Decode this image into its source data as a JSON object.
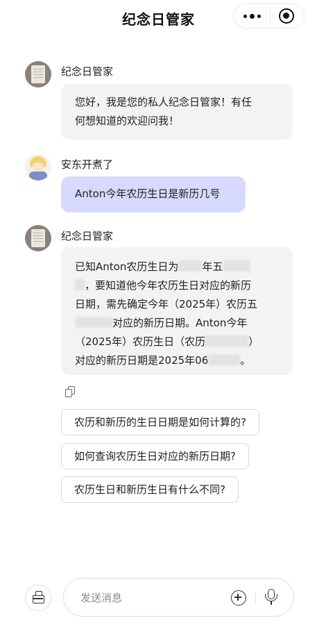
{
  "header": {
    "title": "纪念日管家"
  },
  "messages": [
    {
      "sender": "纪念日管家",
      "lines": [
        "您好，我是您的私人纪念日管家！有任",
        "何想知道的欢迎问我！"
      ]
    },
    {
      "sender": "安东开煮了",
      "text": "Anton今年农历生日是新历几号"
    },
    {
      "sender": "纪念日管家",
      "segments": {
        "l1": "已知Anton农历生日为",
        "l1b": "年五",
        "l2": "，要知道他今年农历生日对应的新历",
        "l3": "日期，需先确定今年（2025年）农历五",
        "l4": "对应的新历日期。Anton今年",
        "l5a": "（2025年）农历生日（农历",
        "l5b": "）",
        "l6a": "对应的新历日期是2025年06",
        "l6b": "。"
      }
    }
  ],
  "suggestions": [
    "农历和新历的生日日期是如何计算的?",
    "如何查询农历生日对应的新历日期?",
    "农历生日和新历生日有什么不同?"
  ],
  "composer": {
    "placeholder": "发送消息"
  },
  "icons": {
    "more": "more-dots-icon",
    "close": "close-miniprogram-icon",
    "copy": "copy-icon",
    "toolbox": "toolbox-icon",
    "add": "plus-circle-icon",
    "voice": "microphone-icon"
  },
  "colors": {
    "user_bubble": "#d7d9ff",
    "bot_bubble": "#f3f3f5"
  }
}
